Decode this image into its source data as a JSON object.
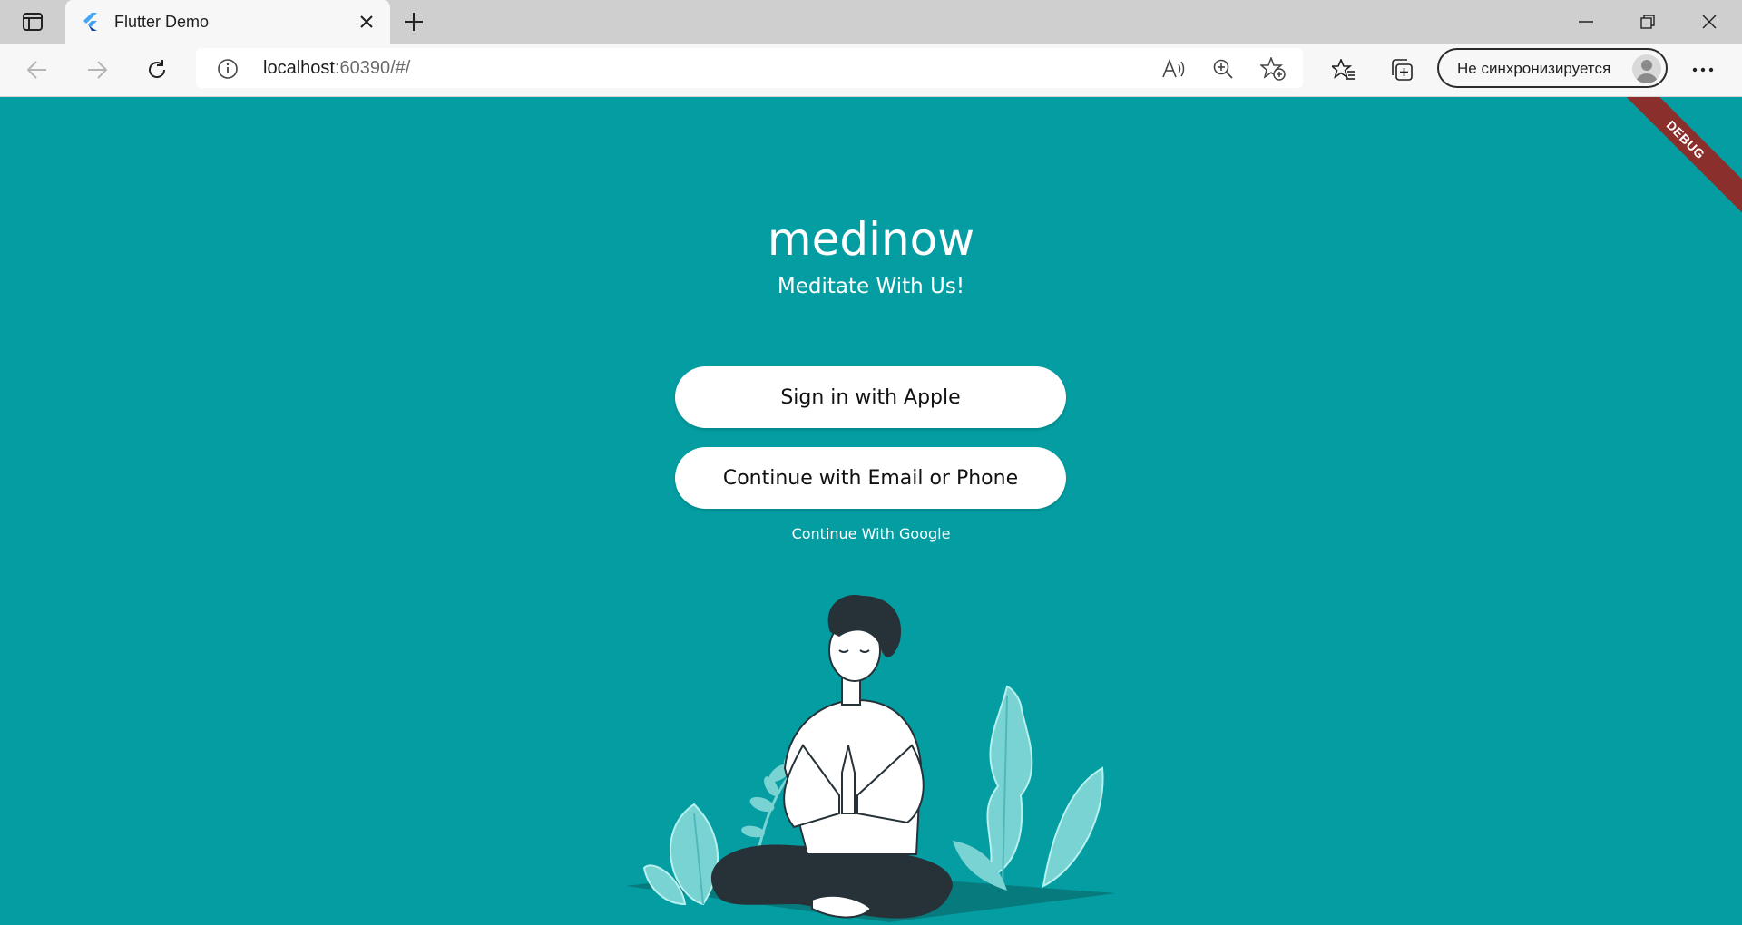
{
  "browser": {
    "tab_title": "Flutter Demo",
    "url_host": "localhost",
    "url_rest": ":60390/#/",
    "sync_label": "Не синхронизируется"
  },
  "app": {
    "debug_banner": "DEBUG",
    "title": "medinow",
    "subtitle": "Meditate With Us!",
    "apple_button": "Sign in with Apple",
    "email_button": "Continue with Email or Phone",
    "google_link": "Continue With Google",
    "background_color": "#049da2"
  },
  "icons": {
    "sidebar": "sidebar-icon",
    "flutter": "flutter-logo-icon",
    "close": "close-icon",
    "new_tab": "plus-icon",
    "back": "back-arrow-icon",
    "forward": "forward-arrow-icon",
    "refresh": "refresh-icon",
    "info": "info-icon",
    "read_aloud": "read-aloud-icon",
    "zoom": "zoom-icon",
    "add_favorite": "star-add-icon",
    "favorites": "favorites-icon",
    "collections": "collections-icon",
    "more": "more-icon"
  }
}
